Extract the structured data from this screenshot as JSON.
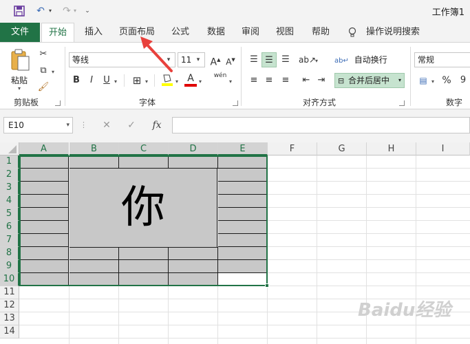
{
  "window": {
    "title": "工作簿1"
  },
  "qat": {
    "save_icon": "save-icon",
    "undo_icon": "undo-icon",
    "redo_icon": "redo-icon",
    "customize_icon": "customize-qat-icon"
  },
  "tabs": {
    "file": "文件",
    "items": [
      "开始",
      "插入",
      "页面布局",
      "公式",
      "数据",
      "审阅",
      "视图",
      "帮助"
    ],
    "active": "开始",
    "tell_me": "操作说明搜索"
  },
  "ribbon": {
    "clipboard": {
      "paste": "粘贴",
      "label": "剪贴板"
    },
    "font": {
      "name": "等线",
      "size": "11",
      "grow": "A",
      "shrink": "A",
      "bold": "B",
      "italic": "I",
      "underline": "U",
      "font_color": "A",
      "phonetic": "wén",
      "label": "字体"
    },
    "alignment": {
      "wrap_text": "自动换行",
      "merge_center": "合并后居中",
      "label": "对齐方式"
    },
    "number": {
      "format": "常规",
      "percent": "%",
      "comma": "9",
      "label": "数字"
    }
  },
  "formula_bar": {
    "name_box": "E10",
    "fx": "fx",
    "cancel": "✕",
    "enter": "✓",
    "value": ""
  },
  "grid": {
    "columns": [
      "A",
      "B",
      "C",
      "D",
      "E",
      "F",
      "G",
      "H",
      "I"
    ],
    "rows": [
      "1",
      "2",
      "3",
      "4",
      "5",
      "6",
      "7",
      "8",
      "9",
      "10",
      "11",
      "12",
      "13",
      "14"
    ],
    "selected_columns": [
      "A",
      "B",
      "C",
      "D",
      "E"
    ],
    "selected_rows": [
      "1",
      "2",
      "3",
      "4",
      "5",
      "6",
      "7",
      "8",
      "9",
      "10"
    ],
    "merged_text": "你"
  },
  "colors": {
    "accent": "#217346",
    "cell_fill": "#c8c8c8"
  },
  "watermark": "Baidu经验"
}
